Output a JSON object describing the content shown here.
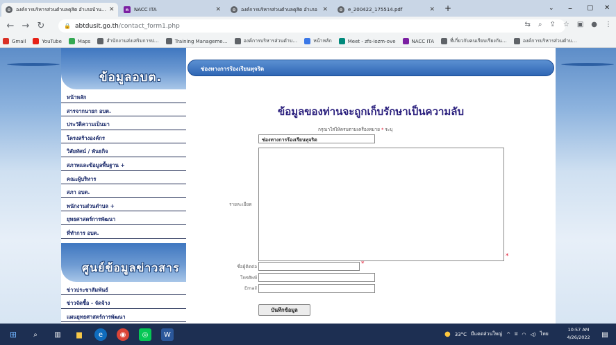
{
  "browser": {
    "tabs": [
      {
        "label": "องค์การบริหารส่วนตำบลดุสิต อำเภอบ้าน…",
        "icon": "chrome-favicon",
        "active": true
      },
      {
        "label": "NACC ITA",
        "icon": "nacc-favicon",
        "active": false
      },
      {
        "label": "องค์การบริหารส่วนตำบลดุสิต อำเภอ",
        "icon": "chrome-favicon",
        "active": false
      },
      {
        "label": "e_200422_175514.pdf",
        "icon": "chrome-favicon",
        "active": false
      }
    ],
    "new_tab": "+",
    "window_controls": {
      "minimize": "–",
      "maximize": "▢",
      "close": "✕"
    },
    "url_host": "abtdusit.go.th",
    "url_path": "/contact_form1.php",
    "bookmarks": [
      {
        "label": "Gmail",
        "color": "#d93025"
      },
      {
        "label": "YouTube",
        "color": "#e62117"
      },
      {
        "label": "Maps",
        "color": "#34a853"
      },
      {
        "label": "สำนักงานส่งเสริมการป…",
        "color": "#5f6368"
      },
      {
        "label": "Training Manageme…",
        "color": "#5f6368"
      },
      {
        "label": "องค์การบริหารส่วนตำบ…",
        "color": "#5f6368"
      },
      {
        "label": "หน้าหลัก",
        "color": "#3b78e7"
      },
      {
        "label": "Meet - zfs-iozm-ove",
        "color": "#00897b"
      },
      {
        "label": "NACC ITA",
        "color": "#7b1fa2"
      },
      {
        "label": "ที่เกี่ยวกับคนเรียบเรียงกัน…",
        "color": "#5f6368"
      },
      {
        "label": "องค์การบริหารส่วนตำบ…",
        "color": "#5f6368"
      }
    ]
  },
  "sidebar": {
    "section1_title": "ข้อมูลอบต.",
    "items": [
      "หน้าหลัก",
      "สารจากนายก อบต.",
      "ประวัติความเป็นมา",
      "โครงสร้างองค์กร",
      "วิสัยทัศน์ / พันธกิจ",
      "สภาพและข้อมูลพื้นฐาน +",
      "คณะผู้บริหาร",
      "สภา อบต.",
      "พนักงานส่วนตำบล +",
      "ยุทธศาสตร์การพัฒนา",
      "ที่ทำการ อบต."
    ],
    "section2_title": "ศูนย์ข้อมูลข่าวสาร",
    "items2": [
      "ข่าวประชาสัมพันธ์",
      "ข่าวจัดซื้อ - จัดจ้าง",
      "แผนยุทธศาสตร์การพัฒนา"
    ]
  },
  "content": {
    "title_bar": "ช่องทางการร้องเรียนทุจริต",
    "heading": "ข้อมูลของท่านจะถูกเก็บรักษาเป็นความลับ",
    "hint": "กรุณาใส่ให้ครบตามเครื่องหมาย",
    "hint_req": "*",
    "hint_tail": "ระบุ",
    "subject_value": "ช่องทางการร้องเรียนทุจริต",
    "detail_label": "รายละเอียด",
    "contact_label": "ชื่อผู้ติดต่อ",
    "phone_label": "โทรศัพท์",
    "email_label": "Email",
    "required_mark": "*",
    "save_label": "บันทึกข้อมูล"
  },
  "taskbar": {
    "weather": "33°C",
    "weather_text": "มีแดดส่วนใหญ่",
    "lang": "ไทย",
    "time": "10:57 AM",
    "date": "4/26/2022",
    "tray_arrow": "^"
  }
}
